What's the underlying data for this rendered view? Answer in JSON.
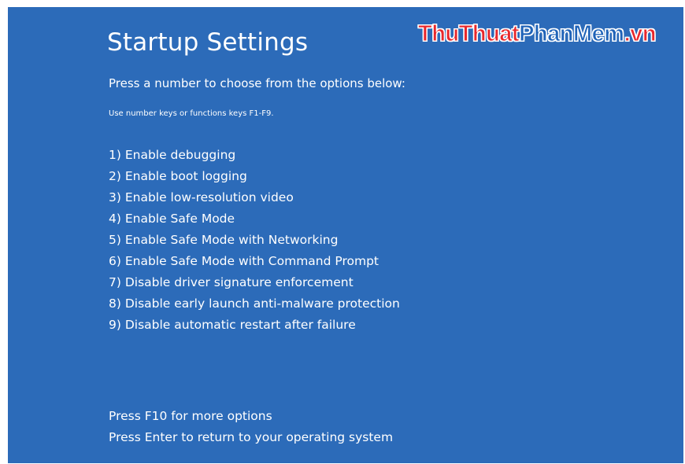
{
  "screen": {
    "title": "Startup Settings",
    "subtitle": "Press a number to choose from the options below:",
    "hint": "Use number keys or functions keys F1-F9.",
    "options": [
      "1) Enable debugging",
      "2) Enable boot logging",
      "3) Enable low-resolution video",
      "4) Enable Safe Mode",
      "5) Enable Safe Mode with Networking",
      "6) Enable Safe Mode with Command Prompt",
      "7) Disable driver signature enforcement",
      "8) Disable early launch anti-malware protection",
      "9) Disable automatic restart after failure"
    ],
    "footer": [
      "Press F10 for more options",
      "Press Enter to return to your operating system"
    ]
  },
  "watermark": {
    "part1": "ThuThuat",
    "part2": "PhanMem",
    "part3": ".vn"
  },
  "colors": {
    "background": "#2c6bb9",
    "text": "#ffffff",
    "watermark_red": "#e8282c",
    "watermark_blue": "#1f63b8"
  }
}
